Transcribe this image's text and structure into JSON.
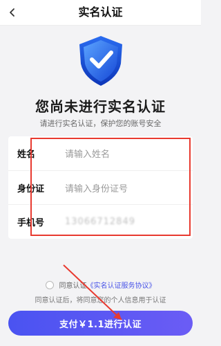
{
  "header": {
    "title": "实名认证"
  },
  "icons": {
    "back": "chevron-left-icon",
    "badge": "shield-check-icon"
  },
  "main": {
    "heading": "您尚未进行实名认证",
    "subheading": "请进行实名认证，保护您的账号安全"
  },
  "form": {
    "name": {
      "label": "姓名",
      "placeholder": "请输入姓名"
    },
    "id_number": {
      "label": "身份证",
      "placeholder": "请输入身份证号"
    },
    "phone": {
      "label": "手机号",
      "value": "13066712849"
    }
  },
  "agreement": {
    "prefix": "同意认证",
    "link": "《实名认证服务协议》",
    "notice": "同意认证后，将同意您的个人信息用于认证"
  },
  "footer": {
    "pay_label": "支付￥1.1进行认证"
  },
  "colors": {
    "accent": "#4a53f1",
    "highlight": "#e8392f"
  }
}
